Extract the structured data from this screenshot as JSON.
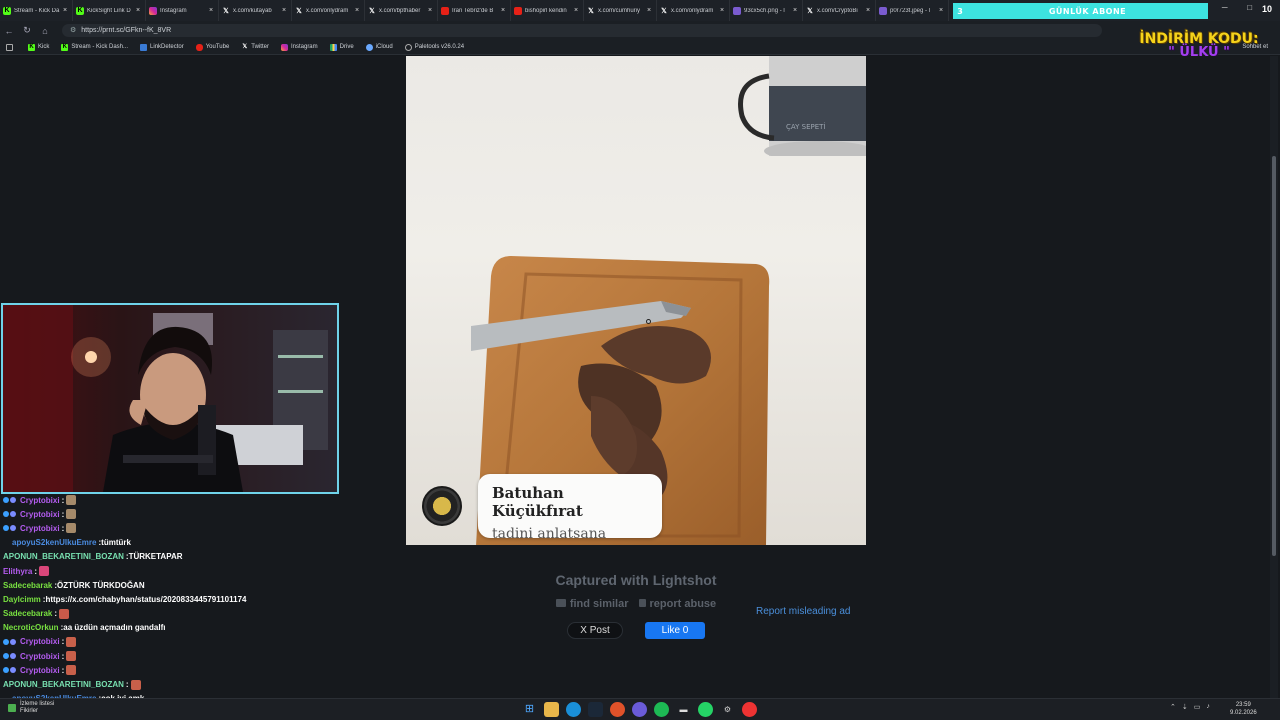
{
  "tabs": [
    {
      "label": "Stream - Kick Da",
      "icon": "kick-icon"
    },
    {
      "label": "KickSight Link D",
      "icon": "kick-icon"
    },
    {
      "label": "Instagram",
      "icon": "instagram-icon"
    },
    {
      "label": "x.com/kutayab",
      "icon": "x-icon"
    },
    {
      "label": "x.com/onlydram",
      "icon": "x-icon"
    },
    {
      "label": "x.com/bpthaber",
      "icon": "x-icon"
    },
    {
      "label": "İran Tebriz'de B",
      "icon": "youtube-icon"
    },
    {
      "label": "bishopirl kendin",
      "icon": "youtube-icon"
    },
    {
      "label": "x.com/cumhuriy",
      "icon": "x-icon"
    },
    {
      "label": "x.com/onlydram",
      "icon": "x-icon"
    },
    {
      "label": "93cx5ch.png - l",
      "icon": "image-icon"
    },
    {
      "label": "x.com/CryptoBi",
      "icon": "x-icon"
    },
    {
      "label": "p0r723t.jpeg - l",
      "icon": "image-icon"
    }
  ],
  "sub_banner": {
    "number": "3",
    "label": "GÜNLÜK ABONE",
    "count": "10"
  },
  "address": {
    "url": "https://prnt.sc/GFkn--fK_8VR"
  },
  "bookmarks": [
    {
      "label": "Kick",
      "icon": "kick"
    },
    {
      "label": "Stream - Kick Dash...",
      "icon": "kick"
    },
    {
      "label": "LinkDetector",
      "icon": "ld"
    },
    {
      "label": "YouTube",
      "icon": "yt"
    },
    {
      "label": "Twitter",
      "icon": "tw"
    },
    {
      "label": "Instagram",
      "icon": "ig"
    },
    {
      "label": "Drive",
      "icon": "dr"
    },
    {
      "label": "iCloud",
      "icon": "ic"
    },
    {
      "label": "Paletools v26.0.24",
      "icon": "pt"
    }
  ],
  "bookmarks_right": "Sohbet et",
  "promo": {
    "title": "İNDİRİM KODU:",
    "code": "\" ÜLKÜ \""
  },
  "caption": {
    "name": "Batuhan Küçükfırat",
    "text": "tadini anlatsana"
  },
  "kettle_brand": "ÇAY SEPETİ",
  "lightshot": {
    "captured": "Captured with Lightshot",
    "find_similar": "find similar",
    "report_abuse": "report abuse",
    "x_post": "X Post",
    "fb_like": "Like 0",
    "report_ad": "Report misleading ad"
  },
  "chat": [
    {
      "user": "Cryptobixi",
      "text": "",
      "color": "#b45cf0",
      "badges": true,
      "emote": "#a58a6a"
    },
    {
      "user": "Cryptobixi",
      "text": "",
      "color": "#b45cf0",
      "badges": true,
      "emote": "#a58a6a"
    },
    {
      "user": "Cryptobixi",
      "text": "",
      "color": "#b45cf0",
      "badges": true,
      "emote": "#a58a6a"
    },
    {
      "user": "apoyuS2kenUlkuEmre",
      "text": "tümtürk",
      "color": "#4a8be0",
      "badges": false,
      "emote": ""
    },
    {
      "user": "APONUN_BEKARETINI_BOZAN",
      "text": "TÜRKETAPAR",
      "color": "#78e0b0",
      "badges": false,
      "emote": ""
    },
    {
      "user": "Elithyra",
      "text": "",
      "color": "#b45cf0",
      "badges": false,
      "emote": "#d9467a"
    },
    {
      "user": "Sadecebarak",
      "text": "ÖZTÜRK TÜRKDOĞAN",
      "color": "#78e040",
      "badges": false,
      "emote": ""
    },
    {
      "user": "Daylcimm",
      "text": "https://x.com/chabyhan/status/2020833445791101174",
      "color": "#78e040",
      "badges": false,
      "emote": ""
    },
    {
      "user": "Sadecebarak",
      "text": "",
      "color": "#78e040",
      "badges": false,
      "emote": "#c85a4a"
    },
    {
      "user": "NecroticOrkun",
      "text": "aa üzdün açmadın gandalfı",
      "color": "#78e040",
      "badges": false,
      "emote": ""
    },
    {
      "user": "Cryptobixi",
      "text": "",
      "color": "#b45cf0",
      "badges": true,
      "emote": "#c8604a"
    },
    {
      "user": "Cryptobixi",
      "text": "",
      "color": "#b45cf0",
      "badges": true,
      "emote": "#c8604a"
    },
    {
      "user": "Cryptobixi",
      "text": "",
      "color": "#b45cf0",
      "badges": true,
      "emote": "#c8604a"
    },
    {
      "user": "APONUN_BEKARETINI_BOZAN",
      "text": "",
      "color": "#78e0b0",
      "badges": false,
      "emote": "#c8604a"
    },
    {
      "user": "apoyuS2kenUlkuEmre",
      "text": "çok iyi amk",
      "color": "#4a8be0",
      "badges": false,
      "emote": ""
    }
  ],
  "taskbar": {
    "weather_title": "İzleme listesi",
    "weather_sub": "Fikirler",
    "time": "23:59",
    "date": "9.02.2026"
  }
}
